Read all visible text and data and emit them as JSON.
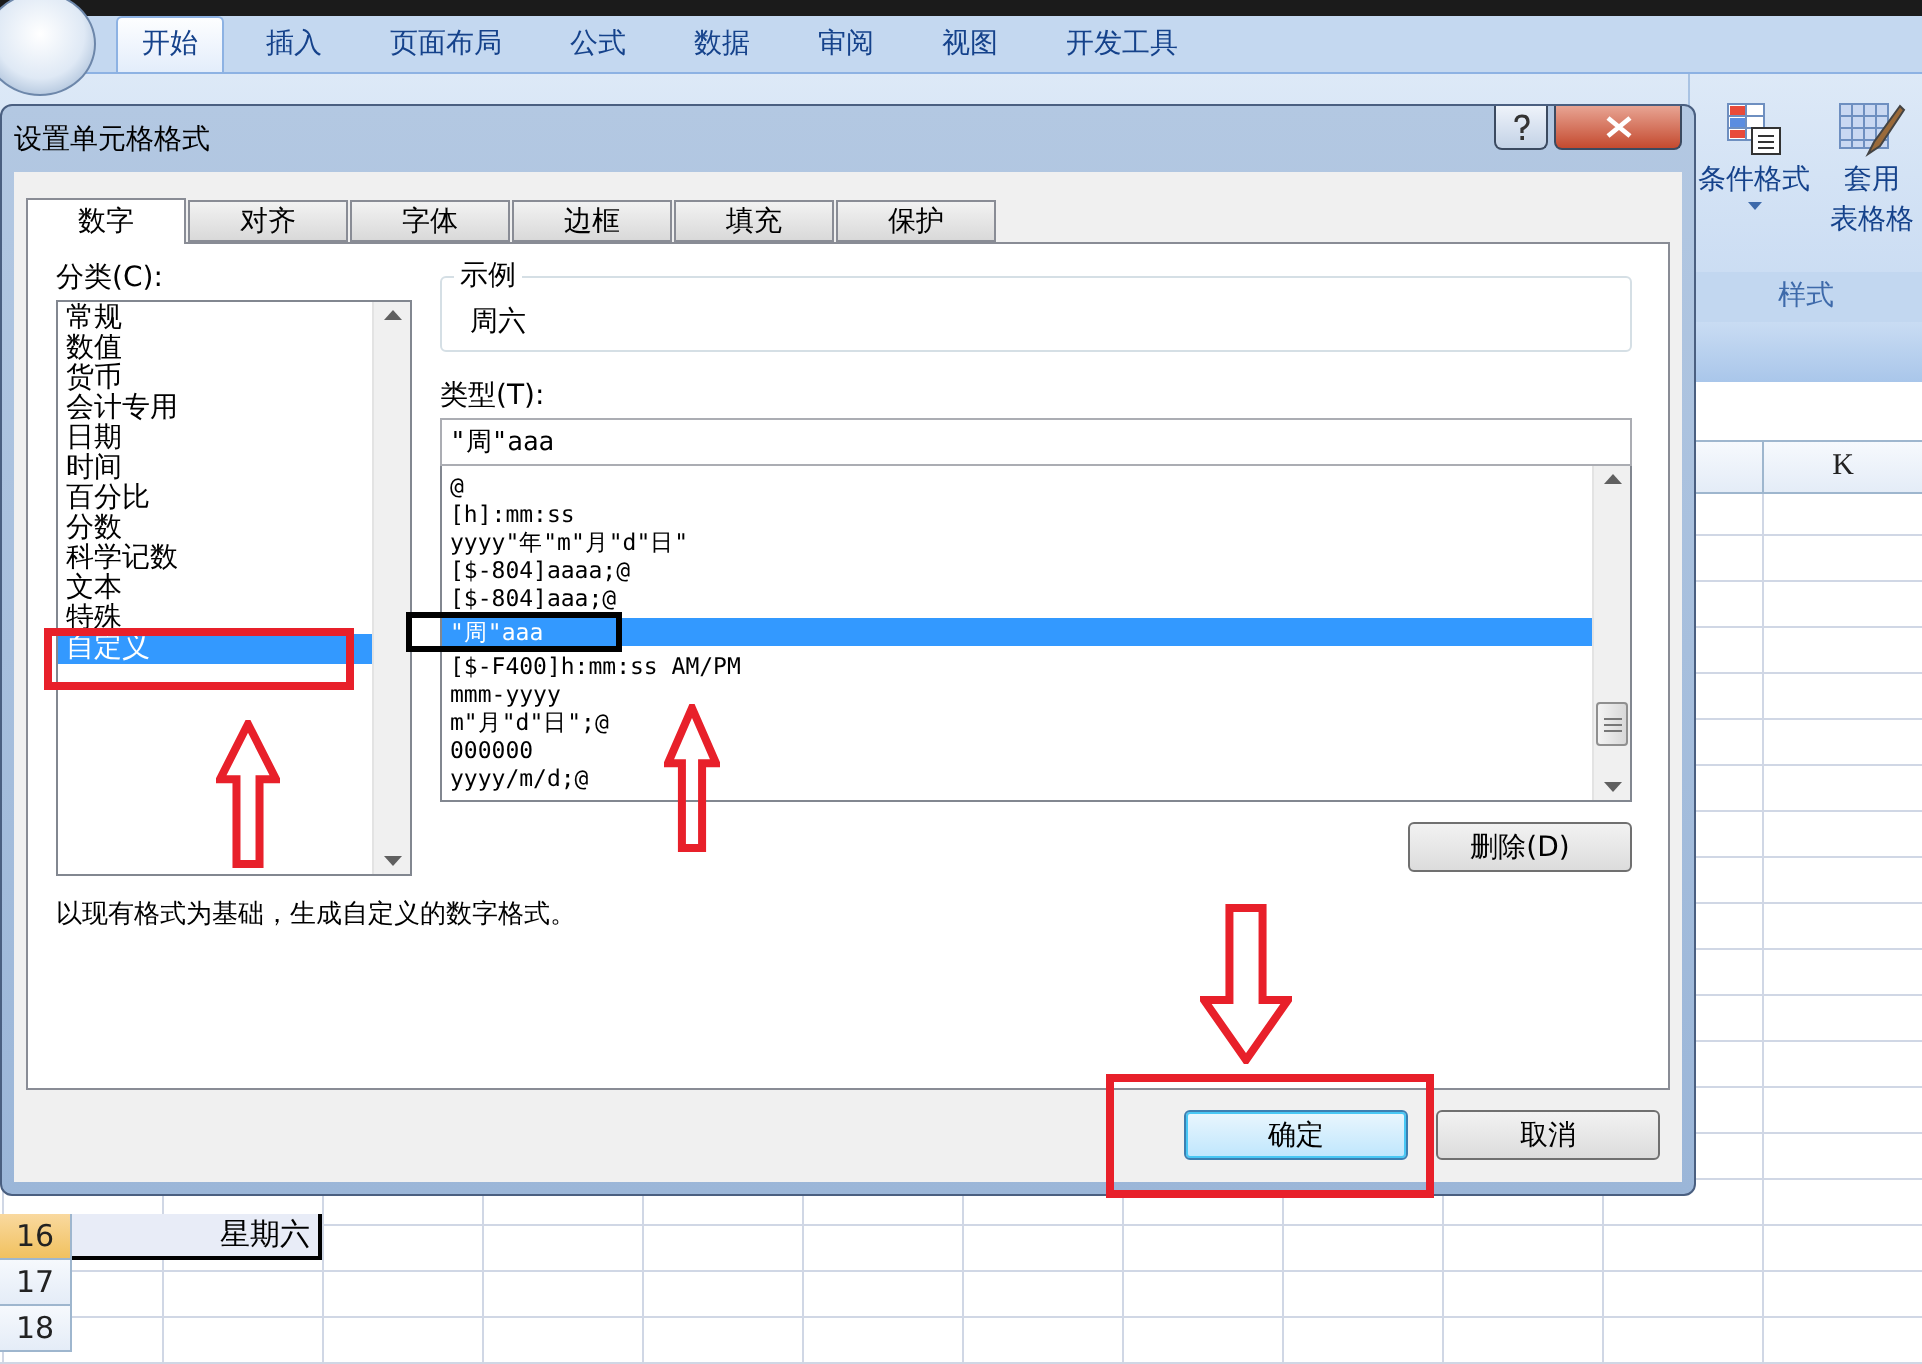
{
  "ribbon": {
    "tabs": [
      {
        "label": "开始",
        "selected": true
      },
      {
        "label": "插入",
        "selected": false
      },
      {
        "label": "页面布局",
        "selected": false
      },
      {
        "label": "公式",
        "selected": false
      },
      {
        "label": "数据",
        "selected": false
      },
      {
        "label": "审阅",
        "selected": false
      },
      {
        "label": "视图",
        "selected": false
      },
      {
        "label": "开发工具",
        "selected": false
      }
    ],
    "group": {
      "label": "样式",
      "commands": [
        {
          "kind": "conditional",
          "lines": [
            "条件格式"
          ],
          "has_menu": true
        },
        {
          "kind": "table",
          "lines": [
            "套用",
            "表格格"
          ],
          "has_menu": false
        }
      ]
    }
  },
  "sheet": {
    "column_headers": [
      "K"
    ],
    "rows": [
      {
        "header": "16",
        "cells": [
          "星期六"
        ],
        "selected": true
      },
      {
        "header": "17",
        "selected": false
      },
      {
        "header": "18",
        "selected": false
      }
    ]
  },
  "dialog": {
    "title": "设置单元格格式",
    "tabs": [
      {
        "label": "数字",
        "selected": true
      },
      {
        "label": "对齐",
        "selected": false
      },
      {
        "label": "字体",
        "selected": false
      },
      {
        "label": "边框",
        "selected": false
      },
      {
        "label": "填充",
        "selected": false
      },
      {
        "label": "保护",
        "selected": false
      }
    ],
    "category": {
      "label": "分类(C):",
      "items": [
        {
          "label": "常规",
          "selected": false
        },
        {
          "label": "数值",
          "selected": false
        },
        {
          "label": "货币",
          "selected": false
        },
        {
          "label": "会计专用",
          "selected": false
        },
        {
          "label": "日期",
          "selected": false
        },
        {
          "label": "时间",
          "selected": false
        },
        {
          "label": "百分比",
          "selected": false
        },
        {
          "label": "分数",
          "selected": false
        },
        {
          "label": "科学记数",
          "selected": false
        },
        {
          "label": "文本",
          "selected": false
        },
        {
          "label": "特殊",
          "selected": false
        },
        {
          "label": "自定义",
          "selected": true
        }
      ]
    },
    "sample": {
      "label": "示例",
      "value": "周六"
    },
    "type": {
      "label": "类型(T):",
      "value": "\"周\"aaa",
      "formats": [
        {
          "label": "@",
          "selected": false
        },
        {
          "label": "[h]:mm:ss",
          "selected": false
        },
        {
          "label": "yyyy\"年\"m\"月\"d\"日\"",
          "selected": false
        },
        {
          "label": "[$-804]aaaa;@",
          "selected": false
        },
        {
          "label": "[$-804]aaa;@",
          "selected": false
        },
        {
          "label": "\"周\"aaa",
          "selected": true
        },
        {
          "label": "[$-F400]h:mm:ss AM/PM",
          "selected": false
        },
        {
          "label": "mmm-yyyy",
          "selected": false
        },
        {
          "label": "m\"月\"d\"日\";@",
          "selected": false
        },
        {
          "label": "000000",
          "selected": false
        },
        {
          "label": "yyyy/m/d;@",
          "selected": false
        }
      ]
    },
    "delete_button": "删除(D)",
    "description": "以现有格式为基础，生成自定义的数字格式。",
    "buttons": [
      {
        "label": "确定",
        "default": true
      },
      {
        "label": "取消",
        "default": false
      }
    ]
  }
}
